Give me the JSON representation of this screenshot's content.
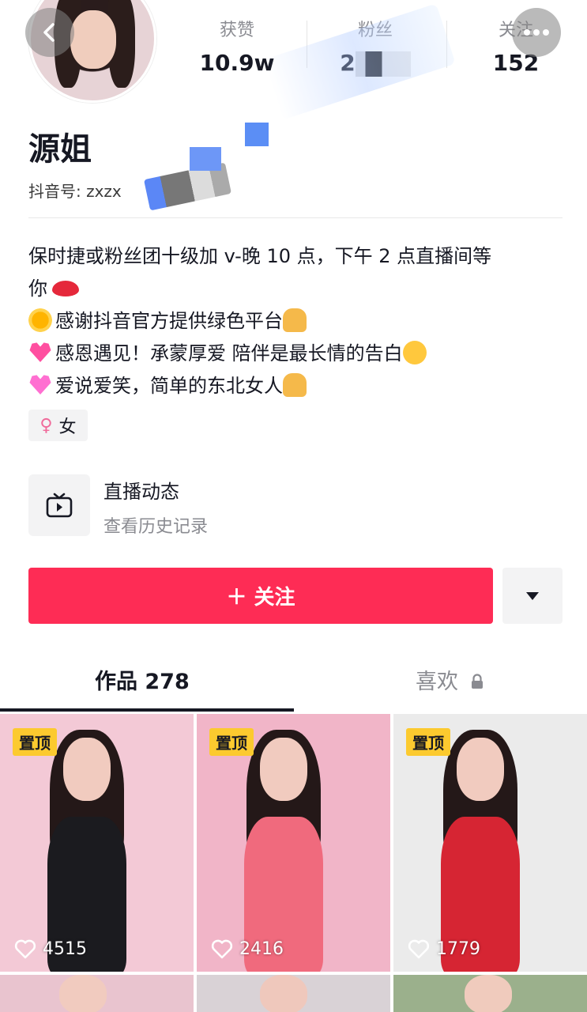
{
  "header": {
    "stats": [
      {
        "label": "获赞",
        "value": "10.9w"
      },
      {
        "label": "粉丝",
        "value": "2"
      },
      {
        "label": "关注",
        "value": "152"
      }
    ]
  },
  "profile": {
    "name": "源姐",
    "douyin_id": "抖音号: zxzx",
    "bio": [
      "保时捷或粉丝团十级加 v-晚 10 点，下午 2 点直播间等",
      "你",
      "感谢抖音官方提供绿色平台",
      "感恩遇见！承蒙厚爱 陪伴是最长情的告白",
      "爱说爱笑，简单的东北女人"
    ],
    "gender_tag": "女"
  },
  "live": {
    "title": "直播动态",
    "subtitle": "查看历史记录"
  },
  "actions": {
    "follow_label": "＋ 关注"
  },
  "tabs": {
    "works": "作品 278",
    "likes": "喜欢"
  },
  "videos": [
    {
      "pinned_label": "置顶",
      "likes": "4515",
      "dress_color": "#1b1b1f",
      "bg_color": "#f3c9d6"
    },
    {
      "pinned_label": "置顶",
      "likes": "2416",
      "dress_color": "#f06a7d",
      "bg_color": "#f1b5c8"
    },
    {
      "pinned_label": "置顶",
      "likes": "1779",
      "dress_color": "#d62533",
      "bg_color": "#ebebeb"
    }
  ],
  "colors": {
    "accent": "#fe2c55",
    "pin_badge": "#fcca2f"
  }
}
